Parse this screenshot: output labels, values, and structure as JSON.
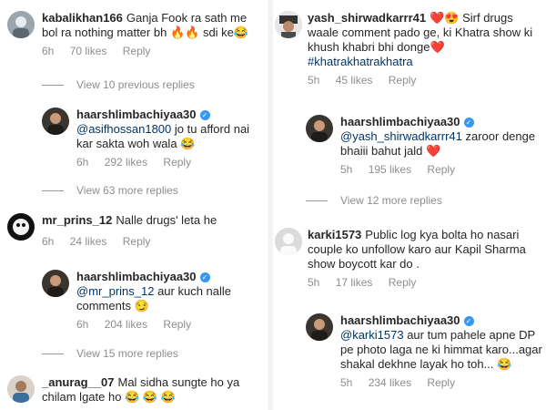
{
  "left": {
    "c1": {
      "username": "kabalikhan166",
      "text": "Ganja Fook ra sath me bol ra nothing matter bh",
      "emoji_a": "🔥",
      "emoji_b": "🔥",
      "text_b": "sdi ke",
      "emoji_c": "😂",
      "time": "6h",
      "likes": "70 likes",
      "reply": "Reply"
    },
    "view1": "View 10 previous replies",
    "c2": {
      "username": "haarshlimbachiyaa30",
      "mention": "@asifhossan1800",
      "text": "jo tu afford nai kar sakta woh wala",
      "emoji": "😂",
      "time": "6h",
      "likes": "292 likes",
      "reply": "Reply"
    },
    "view2": "View 63 more replies",
    "c3": {
      "username": "mr_prins_12",
      "text": "Nalle drugs' leta he",
      "time": "6h",
      "likes": "24 likes",
      "reply": "Reply"
    },
    "c4": {
      "username": "haarshlimbachiyaa30",
      "mention": "@mr_prins_12",
      "text": "aur kuch nalle comments",
      "emoji": "😏",
      "time": "6h",
      "likes": "204 likes",
      "reply": "Reply"
    },
    "view3": "View 15 more replies",
    "c5": {
      "username": "_anurag__07",
      "text": "Mal sidha sungte ho ya chilam lgate ho",
      "emoji": "😂 😂 😂"
    }
  },
  "right": {
    "c1": {
      "username": "yash_shirwadkarrr41",
      "emoji_a": "❤️",
      "emoji_b": "😍",
      "text": "Sirf drugs waale comment pado ge, ki Khatra show ki khush khabri bhi donge",
      "emoji_c": "❤️",
      "hashtag": "#khatrakhatrakhatra",
      "time": "5h",
      "likes": "45 likes",
      "reply": "Reply"
    },
    "c2": {
      "username": "haarshlimbachiyaa30",
      "mention": "@yash_shirwadkarrr41",
      "text": "zaroor denge bhaiii bahut jald",
      "emoji": "❤️",
      "time": "5h",
      "likes": "195 likes",
      "reply": "Reply"
    },
    "view1": "View 12 more replies",
    "c3": {
      "username": "karki1573",
      "text": "Public log kya bolta ho  nasari couple ko unfollow karo aur Kapil Sharma show boycott kar do .",
      "time": "5h",
      "likes": "17 likes",
      "reply": "Reply"
    },
    "c4": {
      "username": "haarshlimbachiyaa30",
      "mention": "@karki1573",
      "text": "aur tum pahele apne DP pe photo laga ne ki himmat karo...agar shakal dekhne layak ho toh...",
      "emoji": "😂",
      "time": "5h",
      "likes": "234 likes",
      "reply": "Reply"
    }
  },
  "colors": {
    "text": "#262626",
    "meta": "#8e8e8e",
    "mention": "#003569",
    "verified": "#3897f0",
    "heart": "#ed4956"
  }
}
